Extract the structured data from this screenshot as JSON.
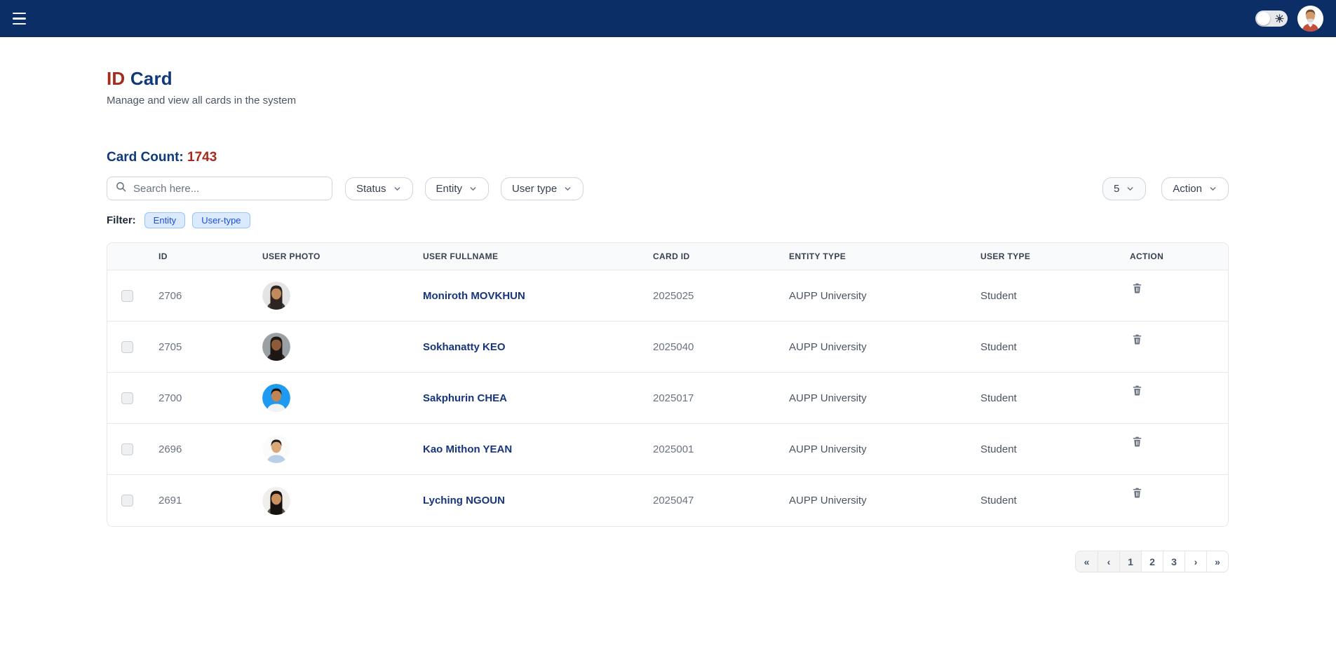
{
  "navbar": {
    "hamburger_icon": "hamburger-icon",
    "theme_toggle_icon": "sun-icon",
    "avatar": {
      "bg": "#ffffff",
      "skin": "#d49a6a",
      "hair": "#6e4f38",
      "beard": "#d8d8d8",
      "shirt": "#c44d3c"
    }
  },
  "page": {
    "title_prefix": "ID",
    "title_suffix": " Card",
    "subtitle": "Manage and view all cards in the system",
    "card_count_label": "Card Count: ",
    "card_count_value": "1743"
  },
  "colors": {
    "navbar_bg": "#0b2e66",
    "title_red": "#a82a1d",
    "title_navy": "#0e3a7c",
    "chip_bg": "#dbeafe",
    "chip_text": "#1d4ed8",
    "name_link": "#17357c"
  },
  "controls": {
    "search_placeholder": "Search here...",
    "dropdowns": [
      {
        "label": "Status"
      },
      {
        "label": "Entity"
      },
      {
        "label": "User type"
      }
    ],
    "page_size": "5",
    "action_label": "Action"
  },
  "filters": {
    "label": "Filter:",
    "chips": [
      {
        "label": "Entity"
      },
      {
        "label": "User-type"
      }
    ]
  },
  "table": {
    "headers": [
      "ID",
      "USER PHOTO",
      "USER FULLNAME",
      "CARD ID",
      "ENTITY TYPE",
      "USER TYPE",
      "ACTION"
    ],
    "rows": [
      {
        "id": "2706",
        "fullname": "Moniroth MOVKHUN",
        "card_id": "2025025",
        "entity_type": "AUPP University",
        "user_type": "Student",
        "avatar": {
          "bg": "#e4e4e5",
          "skin": "#c08a5c",
          "hair": "#2e2420",
          "shirt": "#3a3a3e",
          "hair_style": "long"
        }
      },
      {
        "id": "2705",
        "fullname": "Sokhanatty KEO",
        "card_id": "2025040",
        "entity_type": "AUPP University",
        "user_type": "Student",
        "avatar": {
          "bg": "#9aa0a4",
          "skin": "#8d5a3a",
          "hair": "#1d1713",
          "shirt": "#2b2b2e",
          "hair_style": "long"
        }
      },
      {
        "id": "2700",
        "fullname": "Sakphurin CHEA",
        "card_id": "2025017",
        "entity_type": "AUPP University",
        "user_type": "Student",
        "avatar": {
          "bg": "#1e9bf0",
          "skin": "#c08552",
          "hair": "#15110e",
          "shirt": "#f2f3f5",
          "hair_style": "short"
        }
      },
      {
        "id": "2696",
        "fullname": "Kao Mithon YEAN",
        "card_id": "2025001",
        "entity_type": "AUPP University",
        "user_type": "Student",
        "avatar": {
          "bg": "#fbfbfa",
          "skin": "#d9a878",
          "hair": "#23201c",
          "shirt": "#b9cfe8",
          "hair_style": "short"
        }
      },
      {
        "id": "2691",
        "fullname": "Lyching NGOUN",
        "card_id": "2025047",
        "entity_type": "AUPP University",
        "user_type": "Student",
        "avatar": {
          "bg": "#f1efec",
          "skin": "#c9905e",
          "hair": "#17120f",
          "shirt": "#5c5650",
          "hair_style": "long"
        }
      }
    ]
  },
  "pagination": {
    "items": [
      "«",
      "‹",
      "1",
      "2",
      "3",
      "›",
      "»"
    ],
    "current_page": "1"
  }
}
